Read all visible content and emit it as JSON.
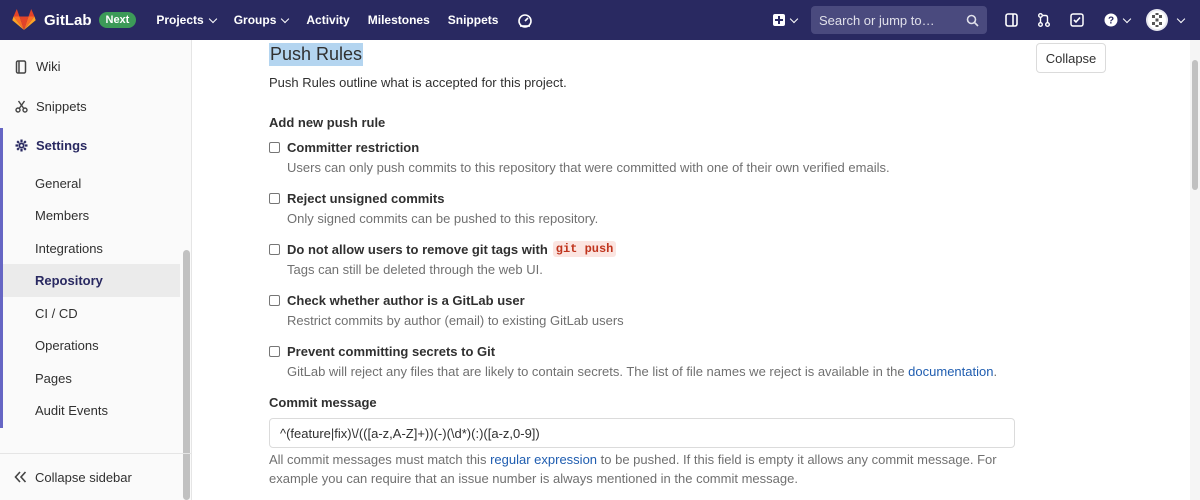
{
  "topbar": {
    "brand": "GitLab",
    "badge": "Next",
    "nav": [
      {
        "label": "Projects",
        "has_caret": true
      },
      {
        "label": "Groups",
        "has_caret": true
      },
      {
        "label": "Activity",
        "has_caret": false
      },
      {
        "label": "Milestones",
        "has_caret": false
      },
      {
        "label": "Snippets",
        "has_caret": false
      }
    ],
    "search_placeholder": "Search or jump to…",
    "colors": {
      "navbar": "#292961",
      "badge": "#3c9a58"
    }
  },
  "sidebar": {
    "items": [
      {
        "label": "Wiki",
        "icon": "book-icon"
      },
      {
        "label": "Snippets",
        "icon": "scissors-icon"
      },
      {
        "label": "Settings",
        "icon": "gear-icon"
      }
    ],
    "settings_sub": [
      "General",
      "Members",
      "Integrations",
      "Repository",
      "CI / CD",
      "Operations",
      "Pages",
      "Audit Events"
    ],
    "active_sub": "Repository",
    "collapse_label": "Collapse sidebar"
  },
  "main": {
    "title": "Push Rules",
    "collapse_button": "Collapse",
    "description": "Push Rules outline what is accepted for this project.",
    "add_heading": "Add new push rule",
    "rules": [
      {
        "label": "Committer restriction",
        "help": "Users can only push commits to this repository that were committed with one of their own verified emails.",
        "checked": false
      },
      {
        "label": "Reject unsigned commits",
        "help": "Only signed commits can be pushed to this repository.",
        "checked": false
      },
      {
        "label": "Do not allow users to remove git tags with",
        "code": "git push",
        "help": "Tags can still be deleted through the web UI.",
        "checked": false
      },
      {
        "label": "Check whether author is a GitLab user",
        "help": "Restrict commits by author (email) to existing GitLab users",
        "checked": false
      },
      {
        "label": "Prevent committing secrets to Git",
        "help": "GitLab will reject any files that are likely to contain secrets. The list of file names we reject is available in the",
        "link": "documentation",
        "help_end": ".",
        "checked": false
      }
    ],
    "commit_message": {
      "heading": "Commit message",
      "value": "^(feature|fix)\\/(([a-z,A-Z]+))(-)(\\d*)(:)([a-z,0-9])",
      "help_pre": "All commit messages must match this",
      "help_link": "regular expression",
      "help_post": "to be pushed. If this field is empty it allows any commit message. For example you can require that an issue number is always mentioned in the commit message."
    }
  }
}
